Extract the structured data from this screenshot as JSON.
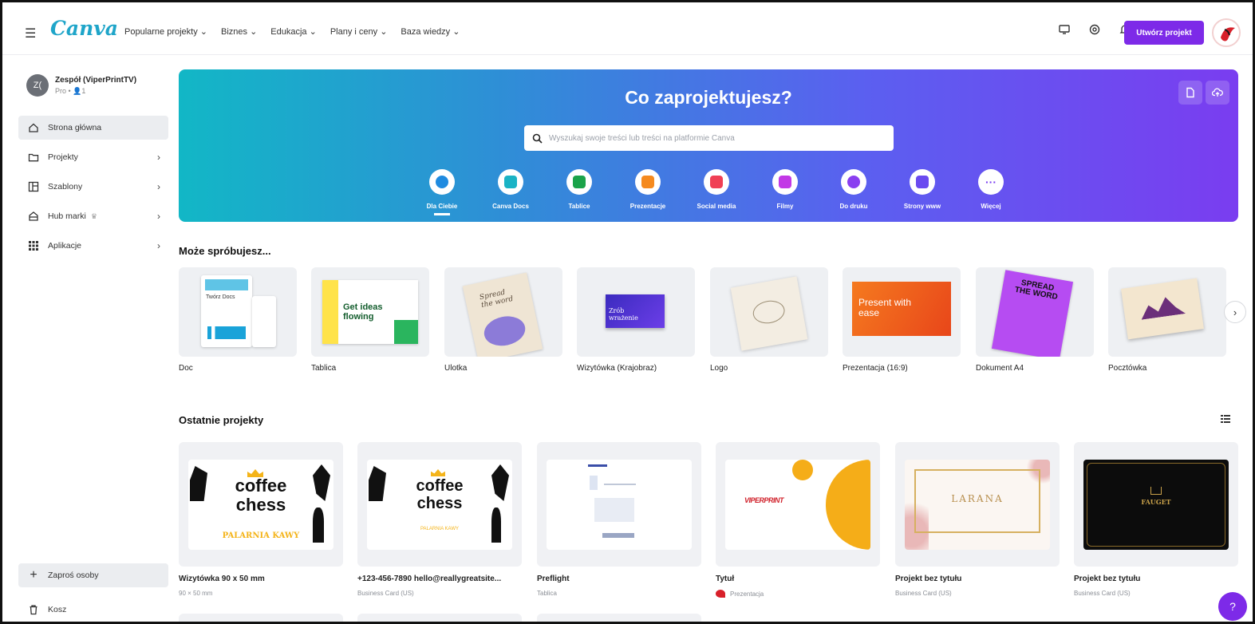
{
  "app": {
    "logo": "Canva"
  },
  "nav": [
    "Popularne projekty ⌄",
    "Biznes ⌄",
    "Edukacja ⌄",
    "Plany i ceny ⌄",
    "Baza wiedzy ⌄"
  ],
  "header": {
    "create_label": "Utwórz projekt"
  },
  "sidebar": {
    "team_avatar": "Z(",
    "team_name": "Zespół (ViperPrintTV)",
    "team_sub": "Pro • 👤1",
    "items": [
      {
        "label": "Strona główna",
        "icon": "home-icon"
      },
      {
        "label": "Projekty",
        "icon": "folder-icon"
      },
      {
        "label": "Szablony",
        "icon": "template-icon"
      },
      {
        "label": "Hub marki",
        "icon": "brand-hub-icon"
      },
      {
        "label": "Aplikacje",
        "icon": "apps-icon"
      }
    ],
    "invite_label": "Zaproś osoby",
    "trash_label": "Kosz"
  },
  "hero": {
    "title": "Co zaprojektujesz?",
    "search_placeholder": "Wyszukaj swoje treści lub treści na platformie Canva",
    "categories": [
      {
        "label": "Dla Ciebie",
        "color": "#1f8be0"
      },
      {
        "label": "Canva Docs",
        "color": "#1ab3c5"
      },
      {
        "label": "Tablice",
        "color": "#1aa34a"
      },
      {
        "label": "Prezentacje",
        "color": "#f58a1f"
      },
      {
        "label": "Social media",
        "color": "#f03f55"
      },
      {
        "label": "Filmy",
        "color": "#c238e6"
      },
      {
        "label": "Do druku",
        "color": "#8a3ff0"
      },
      {
        "label": "Strony www",
        "color": "#6a4af0"
      },
      {
        "label": "Więcej",
        "color": "#7a3df0"
      }
    ]
  },
  "suggest": {
    "title": "Może spróbujesz...",
    "items": [
      {
        "label": "Doc",
        "thumb_text": "Twórz Docs"
      },
      {
        "label": "Tablica",
        "thumb_text": "Get ideas flowing"
      },
      {
        "label": "Ulotka",
        "thumb_text": "Spread the word"
      },
      {
        "label": "Wizytówka (Krajobraz)",
        "thumb_text": "Zrób wrażenie"
      },
      {
        "label": "Logo",
        "thumb_text": ""
      },
      {
        "label": "Prezentacja (16:9)",
        "thumb_text": "Present with ease"
      },
      {
        "label": "Dokument A4",
        "thumb_text": "SPREAD THE WORD"
      },
      {
        "label": "Pocztówka",
        "thumb_text": ""
      }
    ]
  },
  "recent": {
    "title": "Ostatnie projekty",
    "items": [
      {
        "title": "Wizytówka 90 x 50 mm",
        "sub": "90 × 50 mm",
        "thumb_main": "coffee",
        "thumb_sub": "chess",
        "thumb_foot": "PALARNIA KAWY"
      },
      {
        "title": "+123-456-7890 hello@reallygreatsite...",
        "sub": "Business Card (US)",
        "thumb_main": "coffee",
        "thumb_sub": "chess",
        "thumb_foot": "PALARNIA KAWY"
      },
      {
        "title": "Preflight",
        "sub": "Tablica"
      },
      {
        "title": "Tytuł",
        "sub": "Prezentacja",
        "thumb_main": "VIPERPRINT"
      },
      {
        "title": "Projekt bez tytułu",
        "sub": "Business Card (US)",
        "thumb_main": "LARANA"
      },
      {
        "title": "Projekt bez tytułu",
        "sub": "Business Card (US)",
        "thumb_main": "FAUGET"
      }
    ]
  },
  "help": "?"
}
